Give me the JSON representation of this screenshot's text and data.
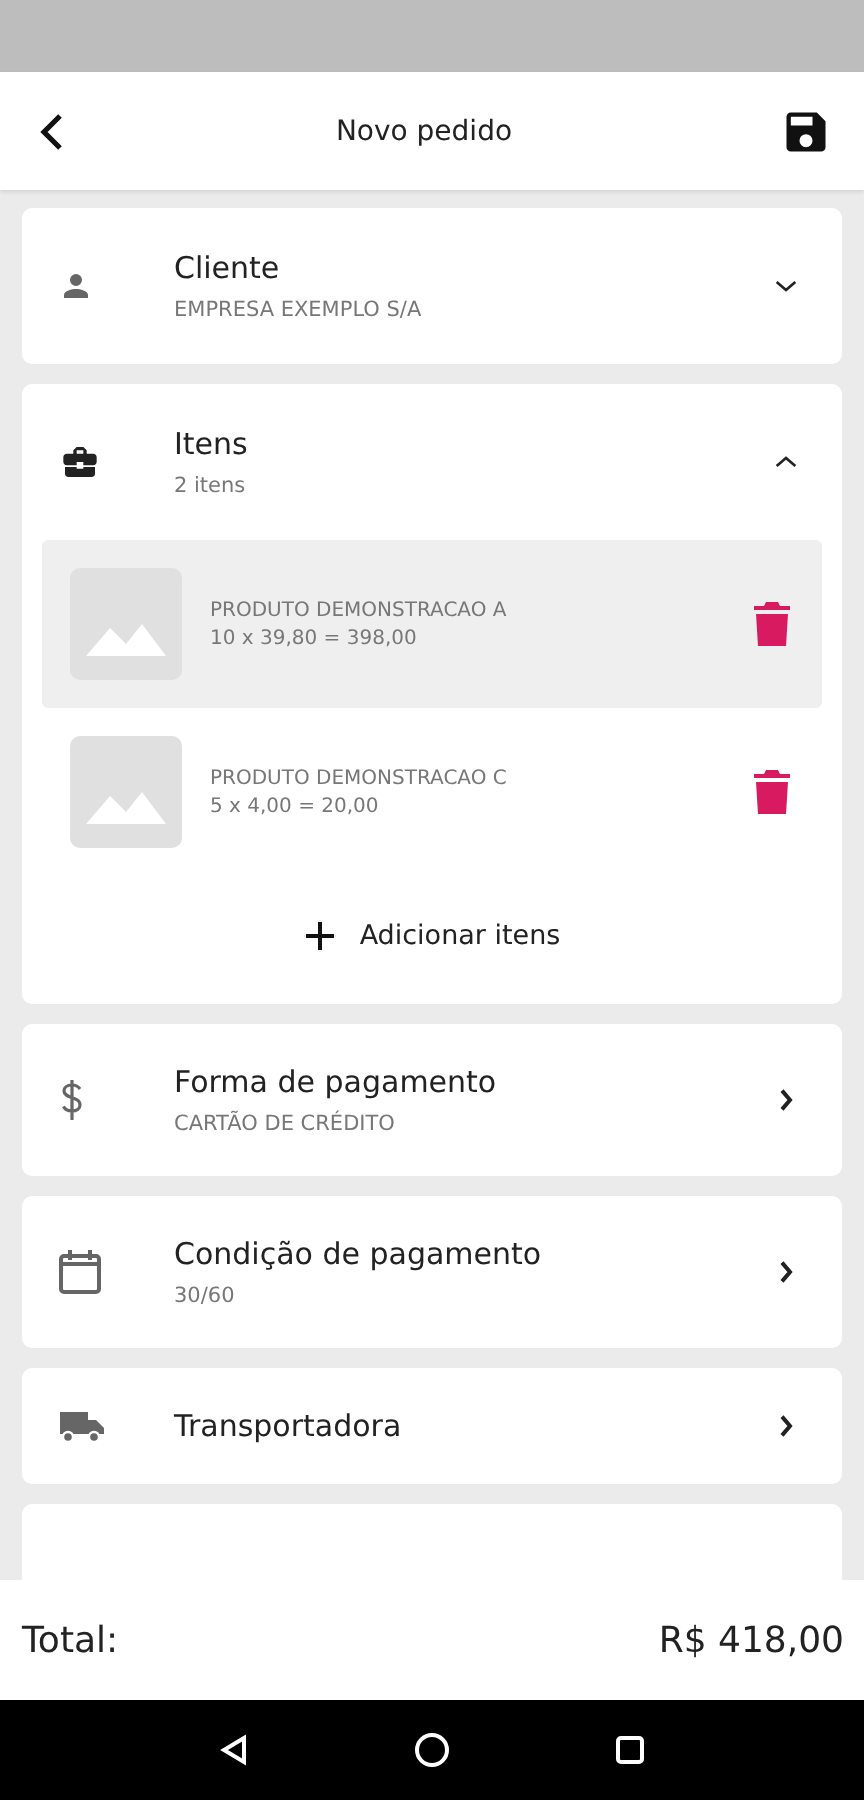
{
  "header": {
    "title": "Novo pedido"
  },
  "cliente": {
    "title": "Cliente",
    "subtitle": "EMPRESA EXEMPLO S/A",
    "expanded": false
  },
  "itens": {
    "title": "Itens",
    "subtitle": "2 itens",
    "expanded": true,
    "products": [
      {
        "name": "PRODUTO DEMONSTRACAO A",
        "calc": "10 x 39,80 = 398,00",
        "selected": true
      },
      {
        "name": "PRODUTO DEMONSTRACAO C",
        "calc": "5 x 4,00 = 20,00",
        "selected": false
      }
    ],
    "add_label": "Adicionar itens"
  },
  "links": [
    {
      "title": "Forma de pagamento",
      "subtitle": "CARTÃO DE CRÉDITO"
    },
    {
      "title": "Condição de pagamento",
      "subtitle": "30/60"
    },
    {
      "title": "Transportadora"
    }
  ],
  "footer": {
    "label": "Total:",
    "value": "R$ 418,00"
  }
}
